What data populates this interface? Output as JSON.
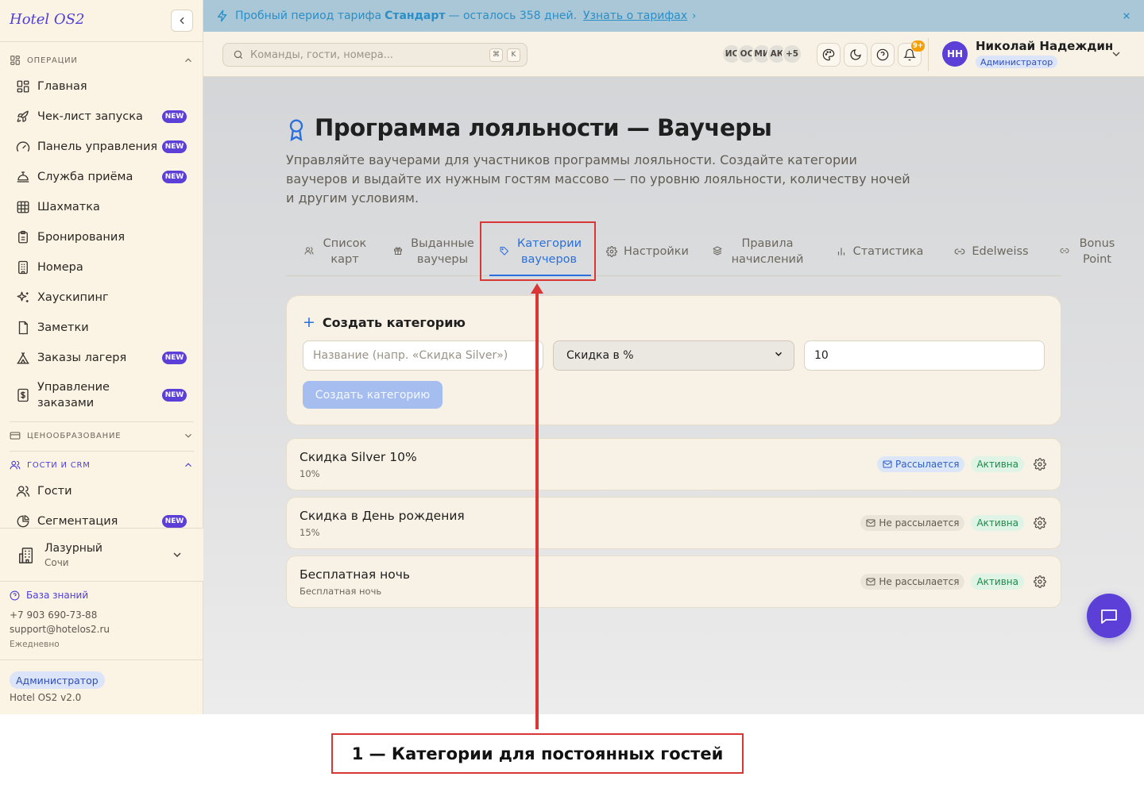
{
  "sidebar": {
    "brand": "Hotel OS2",
    "sections": {
      "operations": "ОПЕРАЦИИ",
      "pricing": "ЦЕНООБРАЗОВАНИЕ",
      "guests_crm": "ГОСТИ И CRM"
    },
    "items": [
      {
        "label": "Главная",
        "icon": "dashboard-grid-icon",
        "new": false
      },
      {
        "label": "Чек-лист запуска",
        "icon": "rocket-icon",
        "new": true
      },
      {
        "label": "Панель управления",
        "icon": "gauge-icon",
        "new": true
      },
      {
        "label": "Служба приёма",
        "icon": "concierge-bell-icon",
        "new": true
      },
      {
        "label": "Шахматка",
        "icon": "grid-icon",
        "new": false
      },
      {
        "label": "Бронирования",
        "icon": "clipboard-icon",
        "new": false
      },
      {
        "label": "Номера",
        "icon": "building-icon",
        "new": false
      },
      {
        "label": "Хаускипинг",
        "icon": "sparkles-icon",
        "new": false
      },
      {
        "label": "Заметки",
        "icon": "note-icon",
        "new": false
      },
      {
        "label": "Заказы лагеря",
        "icon": "tent-icon",
        "new": true
      },
      {
        "label": "Управление заказами",
        "icon": "dollar-receipt-icon",
        "new": true
      },
      {
        "label": "Гости",
        "icon": "users-icon",
        "new": false
      },
      {
        "label": "Сегментация",
        "icon": "pie-chart-icon",
        "new": true
      }
    ],
    "new_badge": "NEW",
    "hotel": {
      "name": "Лазурный",
      "city": "Сочи"
    },
    "knowledge_base": "База знаний",
    "phone": "+7 903 690-73-88",
    "email": "support@hotelos2.ru",
    "hours": "Ежедневно",
    "role": "Администратор",
    "version": "Hotel OS2 v2.0"
  },
  "banner": {
    "text_before": "Пробный период тарифа",
    "plan": "Стандарт",
    "text_after": "— осталось 358 дней.",
    "link": "Узнать о тарифах",
    "arrow": "›",
    "close": "✕"
  },
  "topbar": {
    "search_placeholder": "Команды, гости, номера...",
    "shortcut": [
      "⌘",
      "K"
    ],
    "avatars": [
      "ИС",
      "ОС",
      "МИ",
      "АК",
      "+5"
    ],
    "notification_count": "9+",
    "user": {
      "initials": "НН",
      "name": "Николай Надеждин",
      "role": "Администратор"
    }
  },
  "page": {
    "title": "Программа лояльности — Ваучеры",
    "description": "Управляйте ваучерами для участников программы лояльности. Создайте категории ваучеров и выдайте их нужным гостям массово — по уровню лояльности, количеству ночей и другим условиям."
  },
  "tabs": [
    {
      "label": "Список карт",
      "icon": "users-icon",
      "active": false
    },
    {
      "label": "Выданные ваучеры",
      "icon": "gift-icon",
      "active": false
    },
    {
      "label": "Категории ваучеров",
      "icon": "tag-icon",
      "active": true
    },
    {
      "label": "Настройки",
      "icon": "gear-icon",
      "active": false
    },
    {
      "label": "Правила начислений",
      "icon": "layers-icon",
      "active": false
    },
    {
      "label": "Статистика",
      "icon": "bar-chart-icon",
      "active": false
    },
    {
      "label": "Edelweiss",
      "icon": "link-icon",
      "active": false
    },
    {
      "label": "Bonus Point",
      "icon": "link-icon",
      "active": false
    }
  ],
  "create_form": {
    "title": "Создать категорию",
    "name_placeholder": "Название (напр. «Скидка Silver»)",
    "type_selected": "Скидка в %",
    "value": "10",
    "submit": "Создать категорию"
  },
  "categories": [
    {
      "name": "Скидка Silver 10%",
      "sub": "10%",
      "mailing": "Рассылается",
      "mailing_on": true,
      "status": "Активна"
    },
    {
      "name": "Скидка в День рождения",
      "sub": "15%",
      "mailing": "Не рассылается",
      "mailing_on": false,
      "status": "Активна"
    },
    {
      "name": "Бесплатная ночь",
      "sub": "Бесплатная ночь",
      "mailing": "Не рассылается",
      "mailing_on": false,
      "status": "Активна"
    }
  ],
  "annotation": {
    "caption": "1 — Категории для постоянных гостей"
  },
  "colors": {
    "accent": "#5b3fd6",
    "tab_active": "#2a6fdb",
    "annotation": "#d93636",
    "status_active": "#1f8a4c"
  }
}
